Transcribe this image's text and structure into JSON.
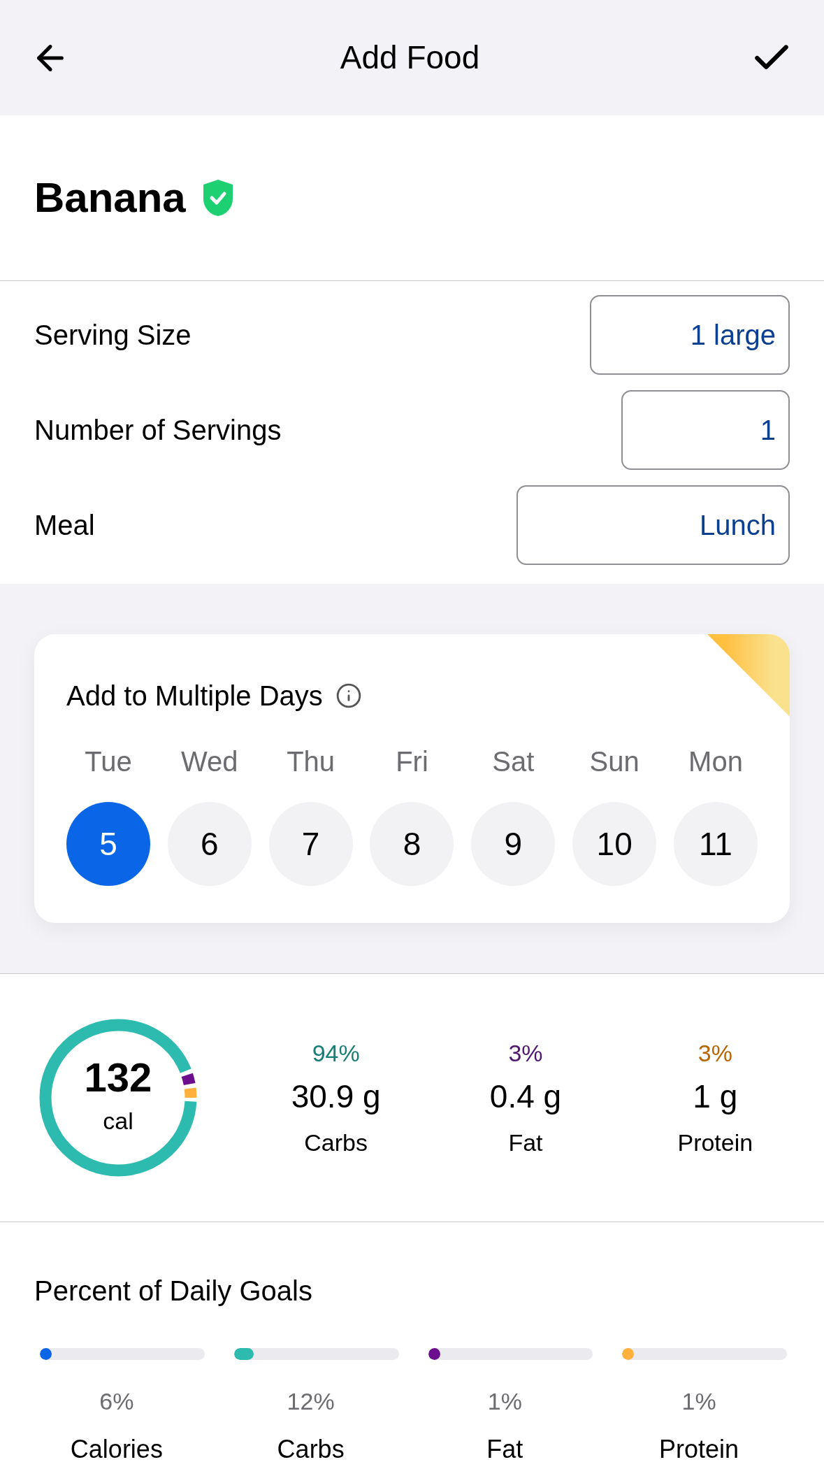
{
  "header": {
    "title": "Add Food"
  },
  "food": {
    "name": "Banana",
    "verified": true
  },
  "fields": [
    {
      "label": "Serving Size",
      "value": "1 large"
    },
    {
      "label": "Number of Servings",
      "value": "1"
    },
    {
      "label": "Meal",
      "value": "Lunch"
    }
  ],
  "multiple_days": {
    "title": "Add to Multiple Days",
    "days": [
      {
        "weekday": "Tue",
        "date": "5",
        "selected": true
      },
      {
        "weekday": "Wed",
        "date": "6",
        "selected": false
      },
      {
        "weekday": "Thu",
        "date": "7",
        "selected": false
      },
      {
        "weekday": "Fri",
        "date": "8",
        "selected": false
      },
      {
        "weekday": "Sat",
        "date": "9",
        "selected": false
      },
      {
        "weekday": "Sun",
        "date": "10",
        "selected": false
      },
      {
        "weekday": "Mon",
        "date": "11",
        "selected": false
      }
    ]
  },
  "summary": {
    "calories": "132",
    "unit": "cal",
    "macros": [
      {
        "percent": "94%",
        "amount": "30.9 g",
        "name": "Carbs",
        "color": "#2dbbb0",
        "level": 0.94
      },
      {
        "percent": "3%",
        "amount": "0.4 g",
        "name": "Fat",
        "color": "#6b0f8f",
        "level": 0.03
      },
      {
        "percent": "3%",
        "amount": "1 g",
        "name": "Protein",
        "color": "#ffb13b",
        "level": 0.03
      }
    ]
  },
  "daily_goals": {
    "title": "Percent of Daily Goals",
    "goals": [
      {
        "percent": "6%",
        "name": "Calories",
        "color": "#0a66e6",
        "level": 0.06
      },
      {
        "percent": "12%",
        "name": "Carbs",
        "color": "#2dbbb0",
        "level": 0.12
      },
      {
        "percent": "1%",
        "name": "Fat",
        "color": "#6b0f8f",
        "level": 0.01
      },
      {
        "percent": "1%",
        "name": "Protein",
        "color": "#ffb13b",
        "level": 0.01
      }
    ]
  }
}
